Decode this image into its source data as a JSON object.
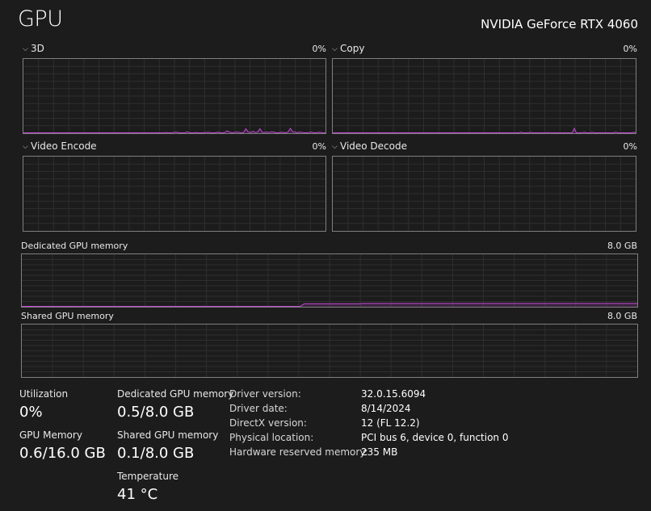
{
  "header": {
    "title": "GPU",
    "device_name": "NVIDIA GeForce RTX 4060"
  },
  "engines": [
    {
      "label": "3D",
      "percent": "0%"
    },
    {
      "label": "Copy",
      "percent": "0%"
    },
    {
      "label": "Video Encode",
      "percent": "0%"
    },
    {
      "label": "Video Decode",
      "percent": "0%"
    }
  ],
  "memory_graphs": {
    "dedicated": {
      "label": "Dedicated GPU memory",
      "max": "8.0 GB"
    },
    "shared": {
      "label": "Shared GPU memory",
      "max": "8.0 GB"
    }
  },
  "stats": {
    "utilization": {
      "label": "Utilization",
      "value": "0%"
    },
    "dedicated_memory": {
      "label": "Dedicated GPU memory",
      "value": "0.5/8.0 GB"
    },
    "gpu_memory": {
      "label": "GPU Memory",
      "value": "0.6/16.0 GB"
    },
    "shared_memory": {
      "label": "Shared GPU memory",
      "value": "0.1/8.0 GB"
    },
    "temperature": {
      "label": "Temperature",
      "value": "41 °C"
    }
  },
  "details": [
    {
      "key": "Driver version:",
      "value": "32.0.15.6094"
    },
    {
      "key": "Driver date:",
      "value": "8/14/2024"
    },
    {
      "key": "DirectX version:",
      "value": "12 (FL 12.2)"
    },
    {
      "key": "Physical location:",
      "value": "PCI bus 6, device 0, function 0"
    },
    {
      "key": "Hardware reserved memory:",
      "value": "235 MB"
    }
  ],
  "colors": {
    "background": "#1c1c1c",
    "graph_border": "#7f7f7f",
    "grid": "#2e2e2e",
    "series": "#c44bd6"
  },
  "chart_data": [
    {
      "type": "line",
      "title": "3D",
      "ylim": [
        0,
        100
      ],
      "grid": true,
      "values": [
        0,
        0,
        0,
        0,
        0,
        0,
        0,
        0,
        0,
        0,
        0,
        0,
        0,
        0,
        0,
        0,
        0,
        0,
        0,
        0,
        0,
        0,
        0,
        0,
        0,
        0,
        0,
        0,
        0,
        0,
        0,
        0,
        0,
        0,
        0,
        0,
        0,
        0,
        0,
        0,
        0,
        0,
        0,
        0,
        0,
        0,
        0,
        0,
        0,
        0,
        0,
        0,
        0,
        0,
        0,
        0,
        0,
        0,
        0,
        0,
        0,
        0.8,
        0,
        0,
        1,
        1.5,
        1,
        0,
        0,
        0,
        1.8,
        0,
        0,
        0,
        1,
        0.5,
        0,
        0,
        1,
        1.2,
        0,
        0,
        0,
        1.5,
        0,
        0,
        1,
        3,
        1.5,
        0.5,
        1,
        1.5,
        1.2,
        0,
        1,
        6,
        1.5,
        1,
        2.5,
        1,
        1.5,
        6,
        1.2,
        1,
        1.5,
        1,
        2,
        1.5,
        0,
        0,
        1.2,
        1,
        0,
        1.5,
        6.5,
        2,
        1.5,
        0.5,
        1.5,
        1,
        0,
        0,
        1,
        1.5,
        0,
        0,
        1.2,
        1,
        0,
        0
      ]
    },
    {
      "type": "line",
      "title": "Copy",
      "ylim": [
        0,
        100
      ],
      "grid": true,
      "values": [
        0,
        0,
        0,
        0,
        0,
        0,
        0,
        0,
        0,
        0,
        0,
        0,
        0,
        0,
        0,
        0,
        0,
        0,
        0,
        0,
        0,
        0,
        0,
        0,
        0,
        0,
        0,
        0,
        0,
        0,
        0,
        0,
        0,
        0,
        0,
        0,
        0,
        0,
        0,
        0,
        0,
        0,
        0,
        0,
        0,
        0,
        0,
        0,
        0,
        0,
        0,
        0,
        0,
        0,
        0,
        0,
        0,
        0,
        0,
        0,
        0,
        0,
        0,
        0,
        0,
        0,
        0,
        0,
        0,
        0,
        0,
        0,
        0,
        0,
        0,
        0,
        0,
        0,
        0,
        0,
        0,
        0,
        0,
        0,
        0,
        0,
        0,
        0,
        0,
        0,
        0,
        0,
        0.5,
        0,
        0,
        1.5,
        0,
        0,
        0,
        0,
        1.2,
        0,
        0,
        0,
        0,
        0,
        0,
        0,
        0,
        1,
        0,
        0,
        0,
        0,
        0,
        0,
        0,
        0,
        0,
        0,
        0,
        0,
        6.5,
        0,
        0,
        0,
        0,
        1.5,
        0,
        0,
        0,
        1.2,
        0,
        0,
        0,
        0,
        0,
        0,
        0,
        0,
        0,
        0,
        0,
        1.5,
        0,
        0,
        0,
        0,
        0,
        0,
        0,
        0,
        1.2,
        0
      ]
    },
    {
      "type": "line",
      "title": "Video Encode",
      "ylim": [
        0,
        100
      ],
      "grid": true,
      "values": []
    },
    {
      "type": "line",
      "title": "Video Decode",
      "ylim": [
        0,
        100
      ],
      "grid": true,
      "values": []
    },
    {
      "type": "area",
      "title": "Dedicated GPU memory",
      "ylim": [
        0,
        8.0
      ],
      "grid": true,
      "values": [
        0,
        0,
        0,
        0,
        0,
        0,
        0,
        0,
        0,
        0,
        0,
        0,
        0,
        0,
        0,
        0,
        0,
        0,
        0,
        0,
        0,
        0,
        0,
        0,
        0,
        0,
        0,
        0,
        0,
        0,
        0,
        0,
        0,
        0,
        0,
        0,
        0,
        0,
        0,
        0,
        0,
        0,
        0,
        0,
        0,
        0,
        0,
        0,
        0,
        0,
        0,
        0,
        0,
        0,
        0,
        0,
        0,
        0,
        0,
        0,
        0,
        0,
        0,
        0,
        0,
        0,
        0,
        0.45,
        0.45,
        0.45,
        0.45,
        0.45,
        0.45,
        0.45,
        0.45,
        0.45,
        0.45,
        0.45,
        0.45,
        0.45,
        0.45,
        0.5,
        0.5,
        0.5,
        0.5,
        0.5,
        0.5,
        0.5,
        0.5,
        0.5,
        0.5,
        0.5,
        0.5,
        0.5,
        0.5,
        0.5,
        0.5,
        0.5,
        0.5,
        0.5,
        0.5,
        0.5,
        0.5,
        0.5,
        0.5,
        0.5,
        0.5,
        0.5,
        0.5,
        0.5,
        0.5,
        0.5,
        0.5,
        0.5,
        0.5,
        0.5,
        0.5,
        0.5,
        0.5,
        0.5,
        0.5,
        0.5,
        0.5,
        0.5,
        0.5,
        0.5,
        0.5,
        0.5,
        0.5,
        0.5,
        0.5,
        0.5,
        0.5,
        0.5,
        0.5,
        0.5,
        0.5,
        0.5,
        0.5,
        0.5,
        0.5,
        0.5,
        0.5,
        0.5,
        0.5,
        0.5,
        0.5
      ]
    },
    {
      "type": "area",
      "title": "Shared GPU memory",
      "ylim": [
        0,
        8.0
      ],
      "grid": true,
      "values": []
    }
  ]
}
